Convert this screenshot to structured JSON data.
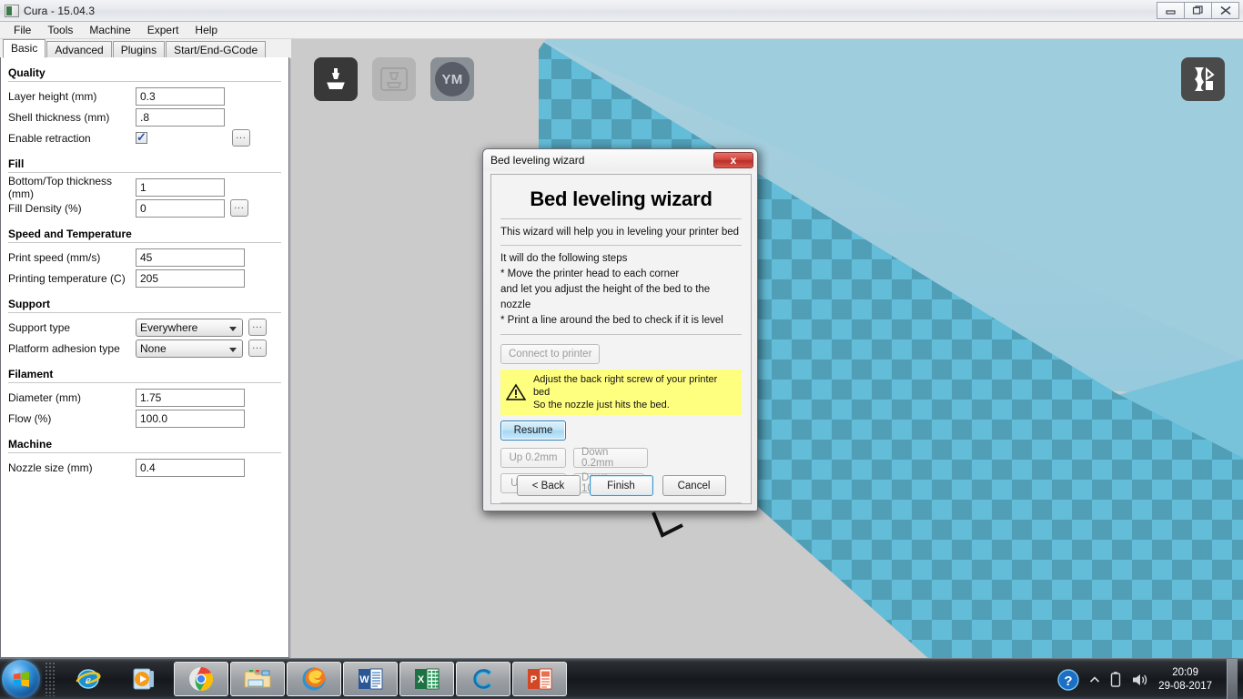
{
  "window": {
    "title": "Cura - 15.04.3",
    "app_icon": "cura-icon",
    "controls": {
      "minimize": "minimize-icon",
      "restore": "restore-icon",
      "close": "close-icon"
    }
  },
  "menu": {
    "items": [
      "File",
      "Tools",
      "Machine",
      "Expert",
      "Help"
    ]
  },
  "tabs": {
    "items": [
      {
        "label": "Basic",
        "active": true
      },
      {
        "label": "Advanced",
        "active": false
      },
      {
        "label": "Plugins",
        "active": false
      },
      {
        "label": "Start/End-GCode",
        "active": false
      }
    ]
  },
  "settings": {
    "groups": [
      {
        "title": "Quality",
        "rows": [
          {
            "label": "Layer height (mm)",
            "type": "text",
            "value": "0.3",
            "more": false
          },
          {
            "label": "Shell thickness (mm)",
            "type": "text",
            "value": ".8",
            "more": false
          },
          {
            "label": "Enable retraction",
            "type": "checkbox",
            "value": true,
            "more": true
          }
        ]
      },
      {
        "title": "Fill",
        "rows": [
          {
            "label": "Bottom/Top thickness (mm)",
            "type": "text",
            "value": "1",
            "more": false
          },
          {
            "label": "Fill Density (%)",
            "type": "text",
            "value": "0",
            "more": true
          }
        ]
      },
      {
        "title": "Speed and Temperature",
        "rows": [
          {
            "label": "Print speed (mm/s)",
            "type": "text",
            "value": "45",
            "more": false
          },
          {
            "label": "Printing temperature (C)",
            "type": "text",
            "value": "205",
            "more": false
          }
        ]
      },
      {
        "title": "Support",
        "rows": [
          {
            "label": "Support type",
            "type": "select",
            "value": "Everywhere",
            "more": true
          },
          {
            "label": "Platform adhesion type",
            "type": "select",
            "value": "None",
            "more": true
          }
        ]
      },
      {
        "title": "Filament",
        "rows": [
          {
            "label": "Diameter (mm)",
            "type": "text",
            "value": "1.75",
            "more": false
          },
          {
            "label": "Flow (%)",
            "type": "text",
            "value": "100.0",
            "more": false
          }
        ]
      },
      {
        "title": "Machine",
        "rows": [
          {
            "label": "Nozzle size (mm)",
            "type": "text",
            "value": "0.4",
            "more": false
          }
        ]
      }
    ],
    "more_button_label": "..."
  },
  "viewport": {
    "toolbar": [
      {
        "name": "load-model-button",
        "icon": "load-model-icon",
        "state": "enabled"
      },
      {
        "name": "prepare-print-button",
        "icon": "print-preview-icon",
        "state": "disabled"
      },
      {
        "name": "youmagine-button",
        "icon": "youmagine-icon",
        "label": "YM",
        "state": "enabled"
      }
    ],
    "view_mode_button": {
      "name": "view-mode-button",
      "icon": "view-mode-icon"
    },
    "colors": {
      "background": "#cbcbcb",
      "back_wall": "#a8cedd",
      "bed_light": "#63bcd8",
      "bed_dark": "#4e9cb4",
      "side_wall": "#79c3da"
    }
  },
  "dialog": {
    "title": "Bed leveling wizard",
    "close_label": "x",
    "heading": "Bed leveling wizard",
    "intro": "This wizard will help you in leveling your printer bed",
    "steps_intro": "It will do the following steps",
    "steps": [
      "* Move the printer head to each corner",
      "  and let you adjust the height of the bed to the nozzle",
      "* Print a line around the bed to check if it is level"
    ],
    "connect_button": "Connect to printer",
    "warning": {
      "icon": "warning-triangle-icon",
      "line1": "Adjust the back right screw of your printer bed",
      "line2": "So the nozzle just hits the bed.",
      "background": "#ffff7f"
    },
    "resume_button": "Resume",
    "jog_buttons": [
      [
        "Up 0.2mm",
        "Down 0.2mm"
      ],
      [
        "Up 10mm",
        "Down 10mm"
      ]
    ],
    "footer_buttons": [
      {
        "label": "< Back",
        "style": "normal"
      },
      {
        "label": "Finish",
        "style": "default"
      },
      {
        "label": "Cancel",
        "style": "normal"
      }
    ]
  },
  "taskbar": {
    "start": "windows-start-orb",
    "items": [
      {
        "name": "internet-explorer-icon",
        "pinned": false
      },
      {
        "name": "windows-media-player-icon",
        "pinned": false
      },
      {
        "name": "google-chrome-icon",
        "pinned": true
      },
      {
        "name": "windows-explorer-icon",
        "pinned": true
      },
      {
        "name": "mozilla-firefox-icon",
        "pinned": true
      },
      {
        "name": "microsoft-word-icon",
        "pinned": true
      },
      {
        "name": "microsoft-excel-icon",
        "pinned": true
      },
      {
        "name": "cura-icon",
        "pinned": true
      },
      {
        "name": "microsoft-powerpoint-icon",
        "pinned": true
      }
    ],
    "tray": {
      "help_icon": "help-question-icon",
      "show_hidden_icon": "chevron-up-icon",
      "battery_icon": "battery-icon",
      "volume_icon": "volume-icon",
      "time": "20:09",
      "date": "29-08-2017"
    }
  }
}
